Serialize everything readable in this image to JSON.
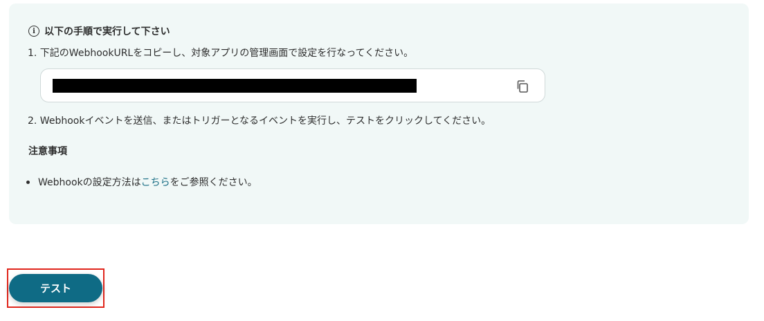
{
  "instructions": {
    "heading": "以下の手順で実行して下さい",
    "step1": "1. 下記のWebhookURLをコピーし、対象アプリの管理画面で設定を行なってください。",
    "step2": "2. Webhookイベントを送信、またはトリガーとなるイベントを実行し、テストをクリックしてください。",
    "copy_icon": "copy-icon"
  },
  "notes": {
    "title": "注意事項",
    "item_prefix": "Webhookの設定方法は",
    "item_link": "こちら",
    "item_suffix": "をご参照ください。"
  },
  "actions": {
    "test_label": "テスト"
  },
  "colors": {
    "panel_bg": "#f1f8f7",
    "accent": "#0f6b85",
    "link": "#1b6f86",
    "highlight": "#e0251b"
  }
}
